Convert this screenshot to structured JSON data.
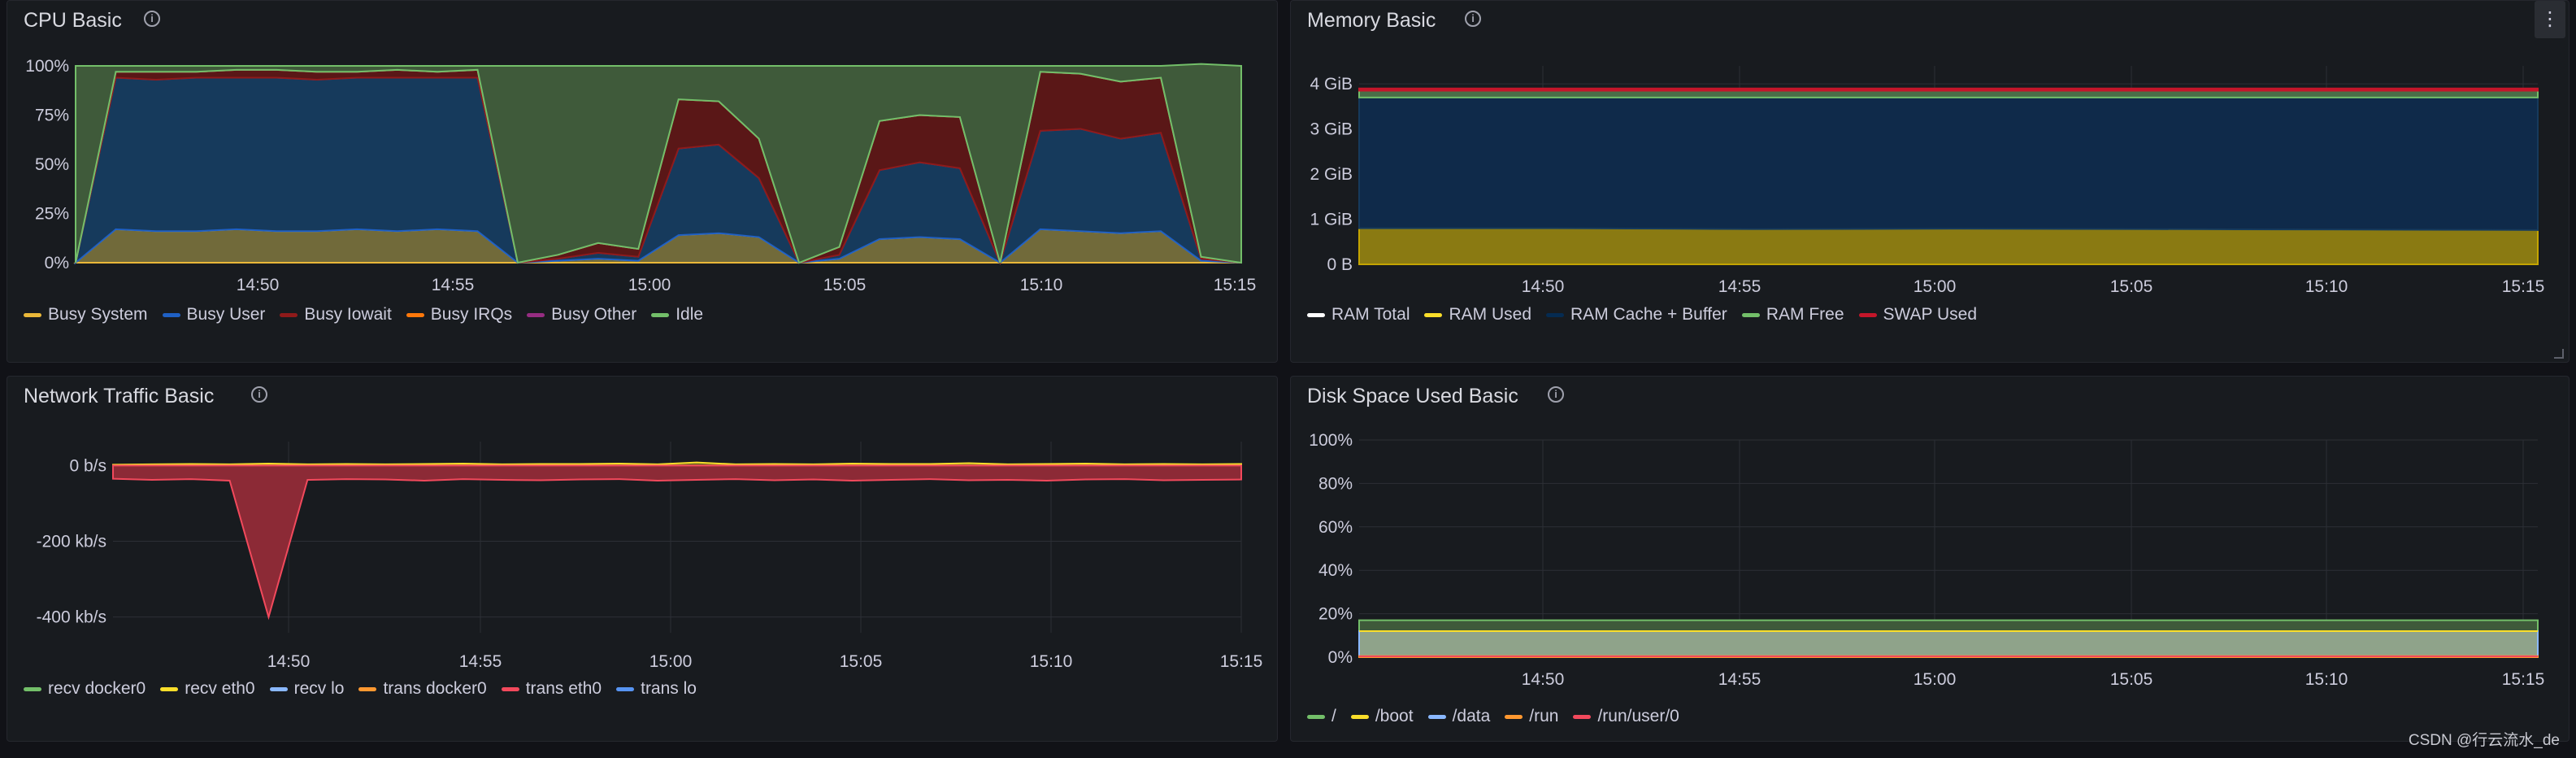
{
  "colors": {
    "green": "#73bf69",
    "yellow": "#fade2a",
    "blue": "#8ab8ff",
    "orange": "#ff9830",
    "red": "#f2495c",
    "purple": "#b877d9",
    "darkred": "#8f1a1a",
    "navy": "#1f60c4",
    "white": "#ffffff"
  },
  "x_ticks": [
    "14:50",
    "14:55",
    "15:00",
    "15:05",
    "15:10",
    "15:15"
  ],
  "watermark": "CSDN @行云流水_de",
  "cpu": {
    "title": "CPU Basic",
    "info_icon": "info-circle-icon",
    "y_ticks": [
      "100%",
      "75%",
      "50%",
      "25%",
      "0%"
    ],
    "legend": [
      {
        "label": "Busy System",
        "color": "#eab839"
      },
      {
        "label": "Busy User",
        "color": "#1f60c4"
      },
      {
        "label": "Busy Iowait",
        "color": "#8f1a1a"
      },
      {
        "label": "Busy IRQs",
        "color": "#ff780a"
      },
      {
        "label": "Busy Other",
        "color": "#962d82"
      },
      {
        "label": "Idle",
        "color": "#73bf69"
      }
    ]
  },
  "memory": {
    "title": "Memory Basic",
    "info_icon": "info-circle-icon",
    "menu_icon": "kebab-menu-icon",
    "menu_glyph": "⋮",
    "y_ticks": [
      "4 GiB",
      "3 GiB",
      "2 GiB",
      "1 GiB",
      "0 B"
    ],
    "legend": [
      {
        "label": "RAM Total",
        "color": "#ffffff"
      },
      {
        "label": "RAM Used",
        "color": "#fade2a"
      },
      {
        "label": "RAM Cache + Buffer",
        "color": "#052b51"
      },
      {
        "label": "RAM Free",
        "color": "#73bf69"
      },
      {
        "label": "SWAP Used",
        "color": "#c4162a"
      }
    ]
  },
  "network": {
    "title": "Network Traffic Basic",
    "info_icon": "info-circle-icon",
    "y_ticks": [
      "0 b/s",
      "-200 kb/s",
      "-400 kb/s"
    ],
    "legend": [
      {
        "label": "recv docker0",
        "color": "#73bf69"
      },
      {
        "label": "recv eth0",
        "color": "#fade2a"
      },
      {
        "label": "recv lo",
        "color": "#8ab8ff"
      },
      {
        "label": "trans docker0",
        "color": "#ff9830"
      },
      {
        "label": "trans eth0",
        "color": "#f2495c"
      },
      {
        "label": "trans lo",
        "color": "#5794f2"
      }
    ]
  },
  "disk": {
    "title": "Disk Space Used Basic",
    "info_icon": "info-circle-icon",
    "y_ticks": [
      "100%",
      "80%",
      "60%",
      "40%",
      "20%",
      "0%"
    ],
    "legend": [
      {
        "label": "/",
        "color": "#73bf69"
      },
      {
        "label": "/boot",
        "color": "#fade2a"
      },
      {
        "label": "/data",
        "color": "#8ab8ff"
      },
      {
        "label": "/run",
        "color": "#ff9830"
      },
      {
        "label": "/run/user/0",
        "color": "#f2495c"
      }
    ]
  },
  "chart_data": [
    {
      "type": "area",
      "title": "CPU Basic",
      "x": [
        "14:46",
        "14:47",
        "14:48",
        "14:49",
        "14:50",
        "14:51",
        "14:52",
        "14:53",
        "14:54",
        "14:55",
        "14:56",
        "14:57",
        "14:58",
        "14:59",
        "15:00",
        "15:01",
        "15:02",
        "15:03",
        "15:04",
        "15:05",
        "15:06",
        "15:07",
        "15:08",
        "15:09",
        "15:10",
        "15:11",
        "15:12",
        "15:13",
        "15:14",
        "15:15"
      ],
      "ylim": [
        0,
        100
      ],
      "series": [
        {
          "name": "Busy System",
          "values": [
            0,
            17,
            16,
            16,
            17,
            16,
            16,
            17,
            16,
            17,
            16,
            0,
            1,
            2,
            1,
            14,
            15,
            13,
            0,
            2,
            12,
            13,
            12,
            0,
            17,
            16,
            15,
            16,
            1,
            0
          ]
        },
        {
          "name": "Busy User",
          "values": [
            0,
            77,
            77,
            78,
            77,
            78,
            77,
            77,
            78,
            77,
            78,
            0,
            1,
            3,
            2,
            44,
            45,
            30,
            0,
            2,
            35,
            38,
            36,
            0,
            50,
            52,
            48,
            50,
            1,
            0
          ]
        },
        {
          "name": "Busy Iowait",
          "values": [
            0,
            3,
            4,
            3,
            4,
            4,
            4,
            3,
            4,
            3,
            4,
            0,
            2,
            5,
            4,
            25,
            22,
            20,
            0,
            4,
            25,
            24,
            26,
            0,
            30,
            28,
            29,
            28,
            1,
            0
          ]
        },
        {
          "name": "Busy IRQs",
          "values": [
            0,
            0,
            0,
            0,
            0,
            0,
            0,
            0,
            0,
            0,
            0,
            0,
            0,
            0,
            0,
            0,
            0,
            0,
            0,
            0,
            0,
            0,
            0,
            0,
            0,
            0,
            0,
            0,
            0,
            0
          ]
        },
        {
          "name": "Busy Other",
          "values": [
            0,
            0,
            0,
            0,
            0,
            0,
            0,
            0,
            0,
            0,
            0,
            0,
            0,
            0,
            0,
            0,
            0,
            0,
            0,
            0,
            0,
            0,
            0,
            0,
            0,
            0,
            0,
            0,
            0,
            0
          ]
        },
        {
          "name": "Idle",
          "values": [
            100,
            3,
            3,
            3,
            2,
            2,
            3,
            3,
            2,
            3,
            2,
            100,
            96,
            90,
            93,
            17,
            18,
            37,
            100,
            92,
            28,
            25,
            26,
            100,
            3,
            4,
            8,
            6,
            98,
            100
          ]
        }
      ]
    },
    {
      "type": "area",
      "title": "Memory Basic",
      "x": [
        "14:46",
        "14:50",
        "14:55",
        "15:00",
        "15:05",
        "15:10",
        "15:15"
      ],
      "ylim": [
        0,
        4.4
      ],
      "series": [
        {
          "name": "RAM Total",
          "values": [
            3.85,
            3.85,
            3.85,
            3.85,
            3.85,
            3.85,
            3.85
          ]
        },
        {
          "name": "RAM Used",
          "values": [
            0.8,
            0.8,
            0.78,
            0.79,
            0.78,
            0.77,
            0.76
          ]
        },
        {
          "name": "RAM Cache + Buffer",
          "values": [
            2.9,
            2.9,
            2.92,
            2.91,
            2.92,
            2.93,
            2.94
          ]
        },
        {
          "name": "RAM Free",
          "values": [
            0.15,
            0.15,
            0.15,
            0.15,
            0.15,
            0.15,
            0.15
          ]
        },
        {
          "name": "SWAP Used",
          "values": [
            0.05,
            0.05,
            0.05,
            0.05,
            0.05,
            0.05,
            0.05
          ]
        }
      ]
    },
    {
      "type": "area",
      "title": "Network Traffic Basic",
      "x": [
        "14:46",
        "14:47",
        "14:48",
        "14:49",
        "14:50",
        "14:51",
        "14:52",
        "14:53",
        "14:54",
        "14:55",
        "14:56",
        "14:57",
        "14:58",
        "14:59",
        "15:00",
        "15:01",
        "15:02",
        "15:03",
        "15:04",
        "15:05",
        "15:06",
        "15:07",
        "15:08",
        "15:09",
        "15:10",
        "15:11",
        "15:12",
        "15:13",
        "15:14",
        "15:15"
      ],
      "ylim": [
        -420,
        20
      ],
      "series": [
        {
          "name": "recv eth0",
          "values": [
            2,
            3,
            4,
            3,
            5,
            3,
            4,
            3,
            4,
            5,
            3,
            4,
            4,
            5,
            3,
            8,
            3,
            4,
            3,
            5,
            4,
            4,
            6,
            3,
            4,
            5,
            3,
            4,
            3,
            4
          ]
        },
        {
          "name": "trans eth0",
          "values": [
            -35,
            -38,
            -36,
            -40,
            -400,
            -38,
            -36,
            -37,
            -40,
            -36,
            -38,
            -39,
            -37,
            -36,
            -40,
            -38,
            -36,
            -39,
            -37,
            -40,
            -38,
            -36,
            -39,
            -38,
            -40,
            -37,
            -36,
            -39,
            -38,
            -37
          ]
        }
      ]
    },
    {
      "type": "area",
      "title": "Disk Space Used Basic",
      "x": [
        "14:46",
        "14:50",
        "14:55",
        "15:00",
        "15:05",
        "15:10",
        "15:15"
      ],
      "ylim": [
        0,
        100
      ],
      "series": [
        {
          "name": "/",
          "values": [
            17,
            17,
            17,
            17,
            17,
            17,
            17
          ]
        },
        {
          "name": "/boot",
          "values": [
            12,
            12,
            12,
            12,
            12,
            12,
            12
          ]
        },
        {
          "name": "/data",
          "values": [
            12,
            12,
            12,
            12,
            12,
            12,
            12
          ]
        },
        {
          "name": "/run",
          "values": [
            0.5,
            0.5,
            0.5,
            0.5,
            0.5,
            0.5,
            0.5
          ]
        },
        {
          "name": "/run/user/0",
          "values": [
            0,
            0,
            0,
            0,
            0,
            0,
            0
          ]
        }
      ]
    }
  ]
}
